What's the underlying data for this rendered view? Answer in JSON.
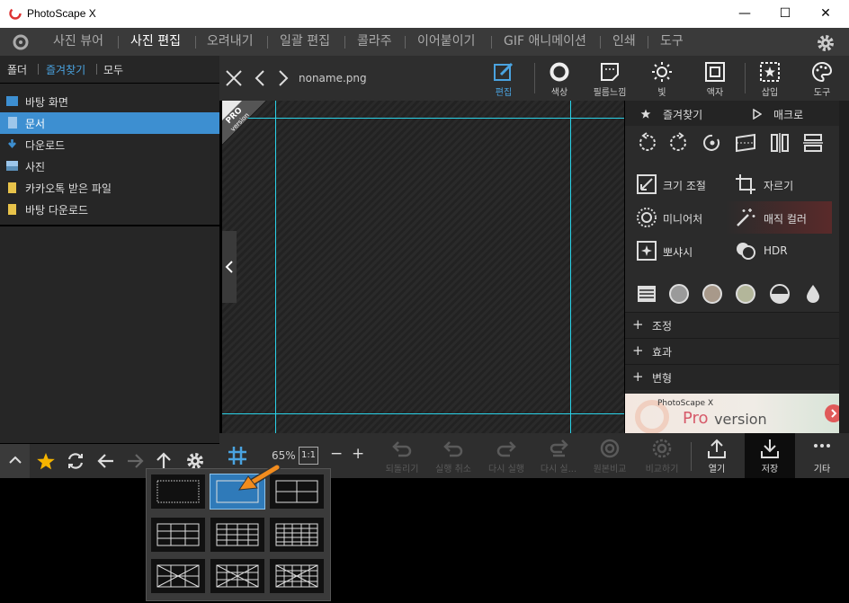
{
  "window": {
    "title": "PhotoScape X",
    "minimize": "—",
    "maximize": "☐",
    "close": "✕"
  },
  "menu": {
    "items": [
      "사진 뷰어",
      "사진 편집",
      "오려내기",
      "일괄 편집",
      "콜라주",
      "이어붙이기",
      "GIF 애니메이션",
      "인쇄",
      "도구"
    ],
    "active_index": 1
  },
  "left_tabs": {
    "folder": "폴더",
    "favorites": "즐겨찾기",
    "all": "모두"
  },
  "folders": [
    {
      "label": "바탕 화면",
      "icon": "desktop-icon",
      "color": "#3d8fd1"
    },
    {
      "label": "문서",
      "icon": "document-icon",
      "color": "#9ec7ea"
    },
    {
      "label": "다운로드",
      "icon": "download-icon",
      "color": "#3d8fd1"
    },
    {
      "label": "사진",
      "icon": "pictures-icon",
      "color": "#6fa8d8"
    },
    {
      "label": "카카오톡 받은 파일",
      "icon": "folder-icon",
      "color": "#e8c34a"
    },
    {
      "label": "바탕 다운로드",
      "icon": "folder-icon",
      "color": "#e8c34a"
    }
  ],
  "selected_folder_index": 1,
  "editor": {
    "filename": "noname.png",
    "pro_badge_line1": "PRO",
    "pro_badge_line2": "version"
  },
  "toolbar": {
    "edit": "편집",
    "color": "색상",
    "film": "필름느낌",
    "light": "빛",
    "frame": "액자",
    "insert": "삽입",
    "tools": "도구"
  },
  "right_panel": {
    "favorites": "즐겨찾기",
    "macro": "매크로",
    "resize": "크기 조절",
    "crop": "자르기",
    "miniature": "미니어처",
    "magic_color": "매직 컬러",
    "bokeh": "뽀샤시",
    "hdr": "HDR",
    "sections": [
      "조정",
      "효과",
      "변형"
    ],
    "promo_title": "PhotoScape X",
    "promo_pro": "Pro",
    "promo_version": " version"
  },
  "bottom": {
    "zoom": "65%",
    "one_to_one": "1:1",
    "minus": "−",
    "plus": "+",
    "revert": "되돌리기",
    "undo": "실행 취소",
    "redo": "다시 실행",
    "redo_all": "다시 실...",
    "original": "원본비교",
    "compare": "비교하기",
    "open": "열기",
    "save": "저장",
    "more": "기타"
  },
  "colors": {
    "accent": "#4aa3e0",
    "guide": "#2ad2e8",
    "selected": "#3d8fd1",
    "popup_selected": "#2f7ab9",
    "arrow": "#f28c1e"
  }
}
